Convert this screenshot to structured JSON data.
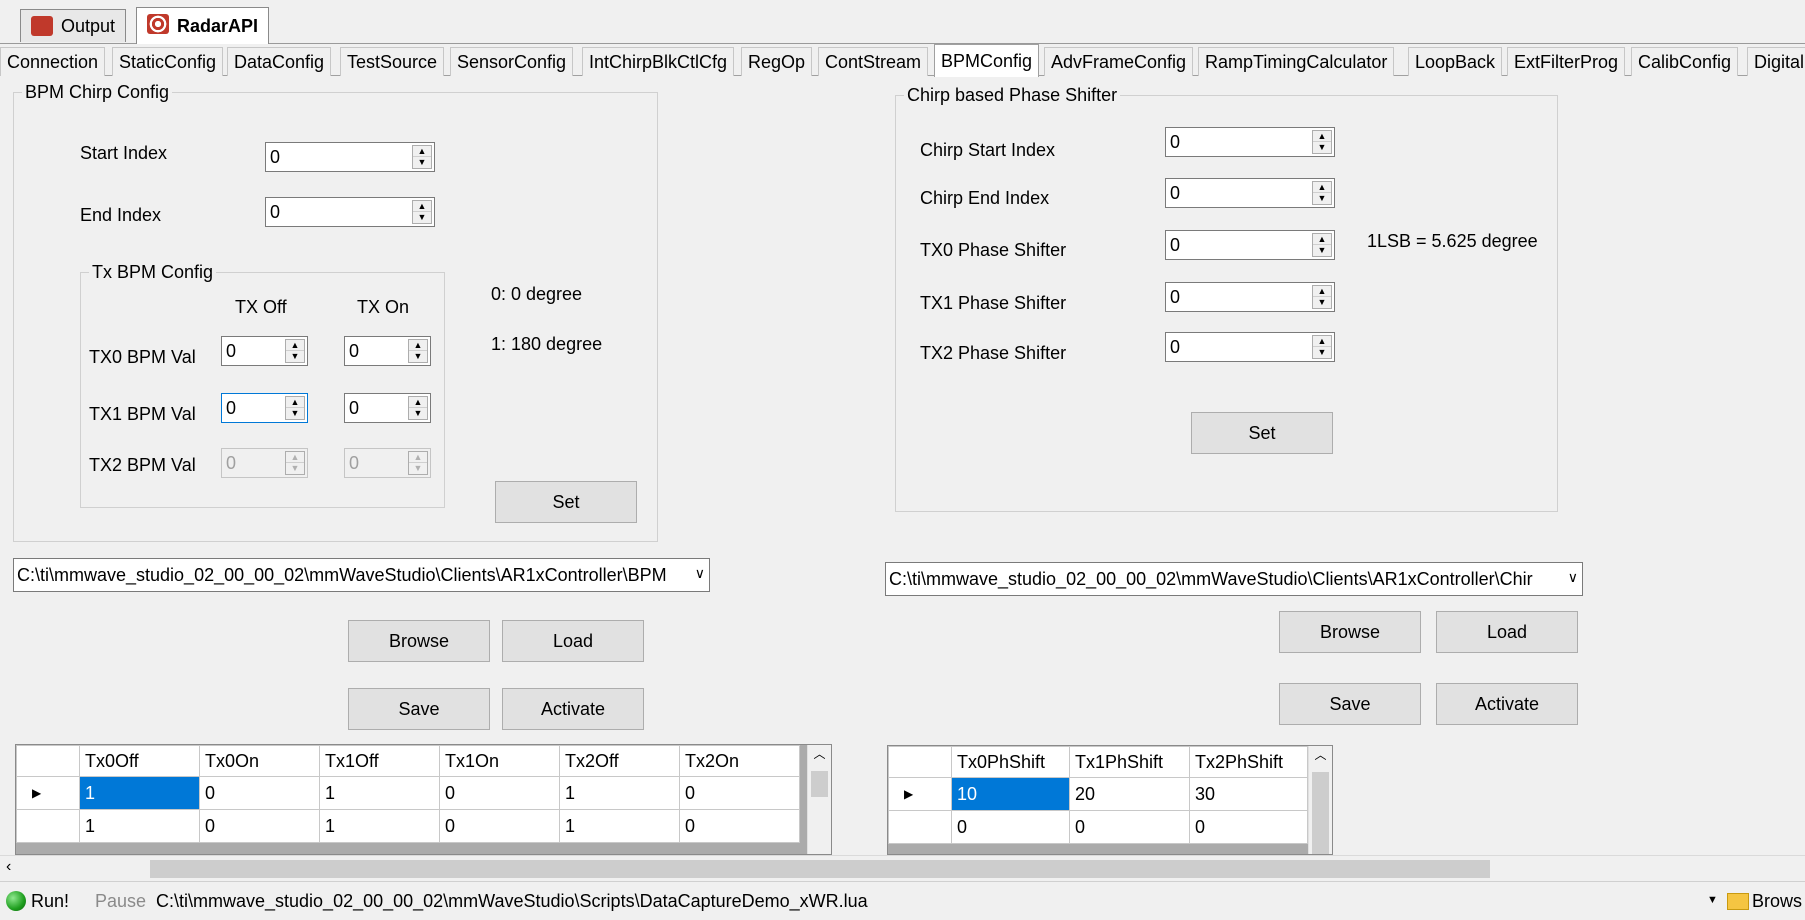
{
  "doc_tabs": [
    {
      "label": "Output"
    },
    {
      "label": "RadarAPI"
    }
  ],
  "func_tabs": [
    "Connection",
    "StaticConfig",
    "DataConfig",
    "TestSource",
    "SensorConfig",
    "IntChirpBlkCtlCfg",
    "RegOp",
    "ContStream",
    "BPMConfig",
    "AdvFrameConfig",
    "RampTimingCalculator",
    "LoopBack",
    "ExtFilterProg",
    "CalibConfig",
    "Digital"
  ],
  "bpm": {
    "legend": "BPM Chirp Config",
    "start_label": "Start Index",
    "start_value": "0",
    "end_label": "End Index",
    "end_value": "0",
    "tx_legend": "Tx BPM Config",
    "col_off": "TX Off",
    "col_on": "TX On",
    "rows": [
      {
        "label": "TX0 BPM Val",
        "off": "0",
        "on": "0"
      },
      {
        "label": "TX1 BPM Val",
        "off": "0",
        "on": "0"
      },
      {
        "label": "TX2 BPM Val",
        "off": "0",
        "on": "0"
      }
    ],
    "note1": "0: 0 degree",
    "note2": "1: 180 degree",
    "set_label": "Set"
  },
  "phase": {
    "legend": "Chirp based Phase Shifter",
    "rows": [
      {
        "label": "Chirp Start Index",
        "value": "0"
      },
      {
        "label": "Chirp End Index",
        "value": "0"
      },
      {
        "label": "TX0 Phase Shifter",
        "value": "0"
      },
      {
        "label": "TX1 Phase Shifter",
        "value": "0"
      },
      {
        "label": "TX2 Phase Shifter",
        "value": "0"
      }
    ],
    "note": "1LSB = 5.625 degree",
    "set_label": "Set"
  },
  "left_file": {
    "path": "C:\\ti\\mmwave_studio_02_00_00_02\\mmWaveStudio\\Clients\\AR1xController\\BPM",
    "browse": "Browse",
    "load": "Load",
    "save": "Save",
    "activate": "Activate"
  },
  "right_file": {
    "path": "C:\\ti\\mmwave_studio_02_00_00_02\\mmWaveStudio\\Clients\\AR1xController\\Chir",
    "browse": "Browse",
    "load": "Load",
    "save": "Save",
    "activate": "Activate"
  },
  "left_grid": {
    "columns": [
      "Tx0Off",
      "Tx0On",
      "Tx1Off",
      "Tx1On",
      "Tx2Off",
      "Tx2On"
    ],
    "rows": [
      [
        "1",
        "0",
        "1",
        "0",
        "1",
        "0"
      ],
      [
        "1",
        "0",
        "1",
        "0",
        "1",
        "0"
      ]
    ]
  },
  "right_grid": {
    "columns": [
      "Tx0PhShift",
      "Tx1PhShift",
      "Tx2PhShift"
    ],
    "rows": [
      [
        "10",
        "20",
        "30"
      ],
      [
        "0",
        "0",
        "0"
      ]
    ]
  },
  "status": {
    "run": "Run!",
    "pause": "Pause",
    "script_path": "C:\\ti\\mmwave_studio_02_00_00_02\\mmWaveStudio\\Scripts\\DataCaptureDemo_xWR.lua",
    "browse": "Brows"
  },
  "colors": {
    "accent": "#0078d7",
    "run_green": "#1e9e1e",
    "output_icon": "#c0392b"
  }
}
